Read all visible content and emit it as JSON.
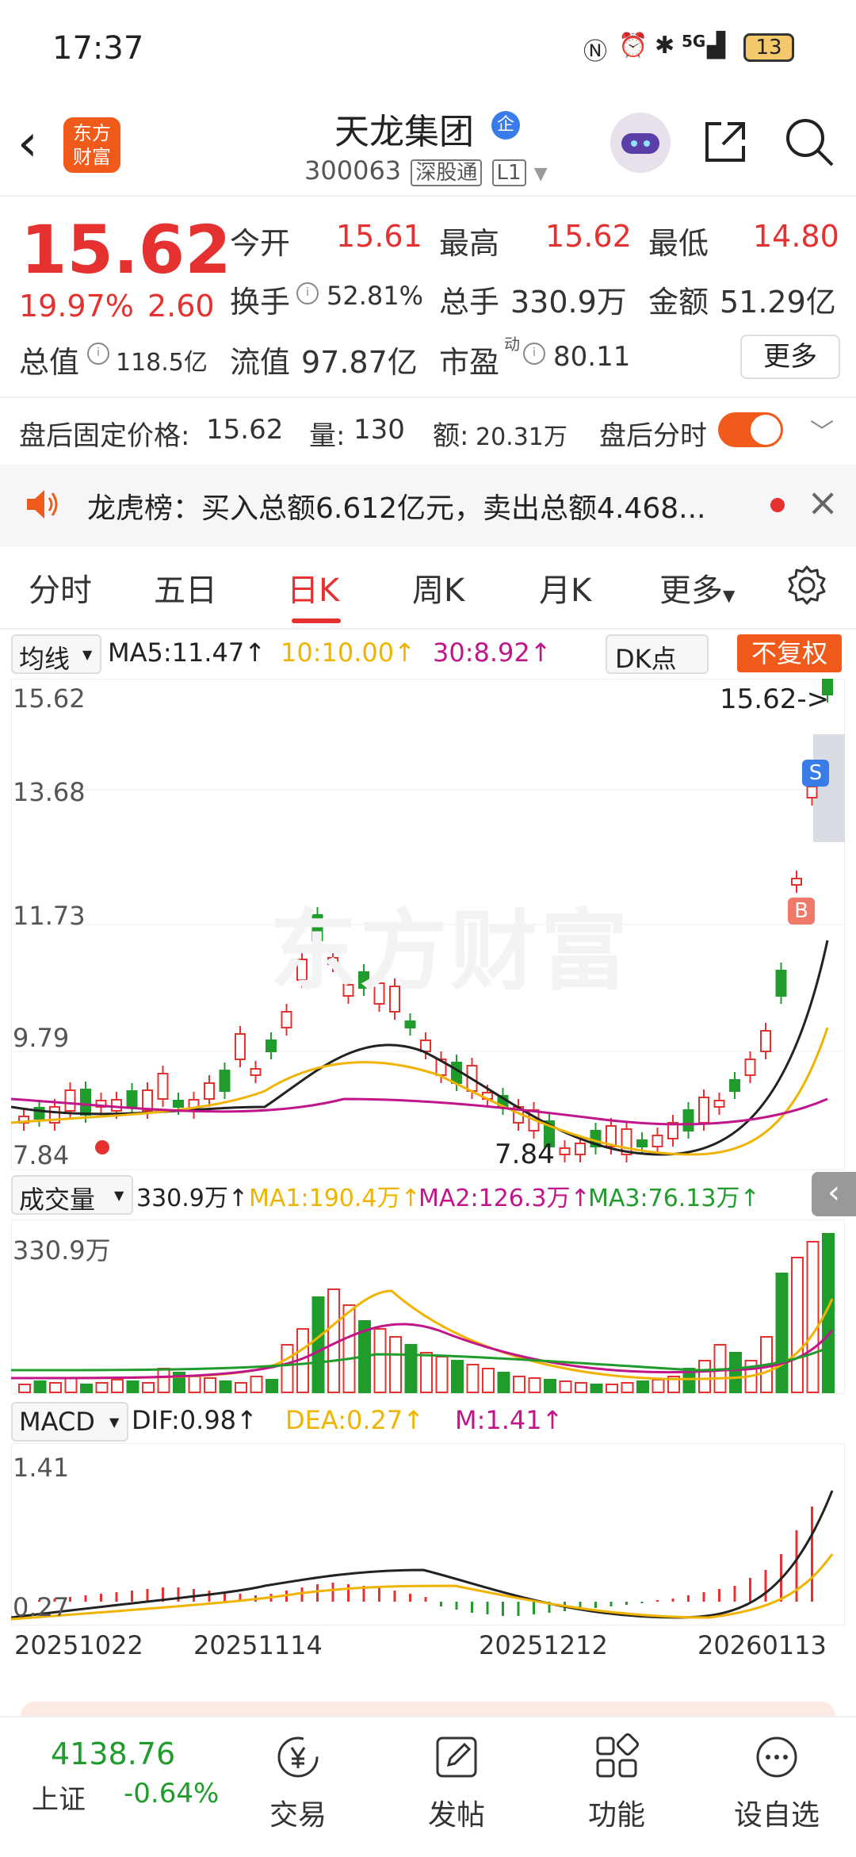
{
  "status_bar": {
    "time": "17:37",
    "network": "5G",
    "battery": "13"
  },
  "header": {
    "logo_line1": "东方",
    "logo_line2": "财富",
    "stock_name": "天龙集团",
    "badge": "企",
    "stock_code": "300063",
    "tag_connect": "深股通",
    "tag_level": "L1"
  },
  "quote": {
    "price": "15.62",
    "change_pct": "19.97%",
    "change": "2.60",
    "open_label": "今开",
    "open": "15.61",
    "high_label": "最高",
    "high": "15.62",
    "low_label": "最低",
    "low": "14.80",
    "turnover_label": "换手",
    "turnover": "52.81%",
    "volume_label": "总手",
    "volume": "330.9万",
    "amount_label": "金额",
    "amount": "51.29亿",
    "mktcap_label": "总值",
    "mktcap": "118.5亿",
    "float_label": "流值",
    "float_cap": "97.87亿",
    "pe_label": "市盈",
    "pe_sup": "动",
    "pe": "80.11",
    "more_label": "更多"
  },
  "after_hours": {
    "price_label": "盘后固定价格:",
    "price": "15.62",
    "vol_label": "量:",
    "vol": "130",
    "amount_label": "额:",
    "amount": "20.31万",
    "timeshare_label": "盘后分时",
    "toggle_on": true
  },
  "news": {
    "text": "龙虎榜：买入总额6.612亿元，卖出总额4.468..."
  },
  "tabs": [
    {
      "label": "分时"
    },
    {
      "label": "五日"
    },
    {
      "label": "日K",
      "active": true
    },
    {
      "label": "周K"
    },
    {
      "label": "月K"
    },
    {
      "label": "更多"
    }
  ],
  "ma_row": {
    "selector": "均线",
    "ma5": "MA5:11.47",
    "ma10": "10:10.00",
    "ma30": "30:8.92",
    "dk": "DK点",
    "adjust": "不复权",
    "colors": {
      "ma5": "#222222",
      "ma10": "#f0b400",
      "ma30": "#c0168a"
    }
  },
  "kline": {
    "y_labels": [
      "15.62",
      "13.68",
      "11.73",
      "9.79",
      "7.84"
    ],
    "last_price_marker": "15.62->",
    "low_marker": "7.84",
    "watermark": "东方财富",
    "sell_tag": "S",
    "buy_tag": "B"
  },
  "volume": {
    "selector": "成交量",
    "vol": "330.9万",
    "ma1": "MA1:190.4万",
    "ma2": "MA2:126.3万",
    "ma3": "MA3:76.13万",
    "y_label": "330.9万",
    "colors": {
      "ma1": "#f0b400",
      "ma2": "#c0168a",
      "ma3": "#1f9c2b"
    }
  },
  "macd": {
    "selector": "MACD",
    "dif": "DIF:0.98",
    "dea": "DEA:0.27",
    "m": "M:1.41",
    "y_top": "1.41",
    "y_mid": "0.27",
    "colors": {
      "dif": "#222222",
      "dea": "#f0b400",
      "m": "#c0168a"
    }
  },
  "dates": [
    "20251022",
    "20251114",
    "20251212",
    "20260113"
  ],
  "bottom_bar": {
    "index_value": "4138.76",
    "index_name": "上证",
    "index_change": "-0.64%",
    "items": [
      {
        "label": "交易"
      },
      {
        "label": "发帖"
      },
      {
        "label": "功能"
      },
      {
        "label": "设自选"
      }
    ]
  },
  "chart_data": {
    "type": "candlestick",
    "title": "",
    "x_range": [
      "20251022",
      "20260113"
    ],
    "ylim": [
      7.84,
      15.62
    ],
    "last_close": 15.62,
    "period_low": 7.84,
    "ma": {
      "MA5": 11.47,
      "MA10": 10.0,
      "MA30": 8.92
    }
  }
}
